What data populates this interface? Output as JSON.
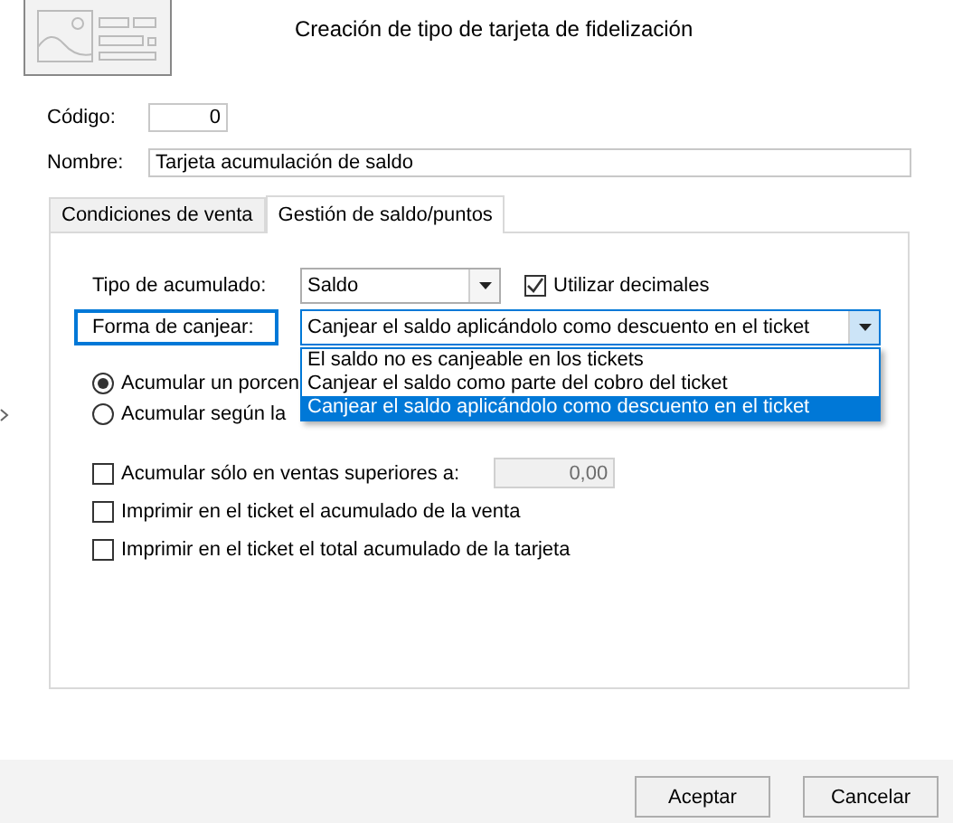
{
  "window": {
    "title": "Creación de tipo de tarjeta de fidelización"
  },
  "codigo": {
    "label": "Código:",
    "value": "0"
  },
  "nombre": {
    "label": "Nombre:",
    "value": "Tarjeta acumulación de saldo"
  },
  "tabs": [
    {
      "label": "Condiciones de venta",
      "selected": false
    },
    {
      "label": "Gestión de saldo/puntos",
      "selected": true
    }
  ],
  "tipo_acumulado": {
    "label": "Tipo de acumulado:",
    "value": "Saldo"
  },
  "utilizar_decimales": {
    "label": "Utilizar decimales",
    "checked": true
  },
  "forma_canjear": {
    "label": "Forma de canjear:",
    "value": "Canjear el saldo aplicándolo como descuento en el ticket",
    "expanded": true,
    "options": [
      {
        "label": "El saldo no es canjeable en los tickets",
        "selected": false
      },
      {
        "label": "Canjear el saldo como parte del cobro del ticket",
        "selected": false
      },
      {
        "label": "Canjear el saldo aplicándolo como descuento en el ticket",
        "selected": true
      }
    ]
  },
  "radios": [
    {
      "label": "Acumular un porcen",
      "selected": true
    },
    {
      "label": "Acumular según la",
      "selected": false
    }
  ],
  "checkboxes": [
    {
      "label": "Acumular sólo en ventas superiores a:",
      "checked": false,
      "amount": "0,00"
    },
    {
      "label": "Imprimir en el ticket el acumulado de la venta",
      "checked": false
    },
    {
      "label": "Imprimir en el ticket el total acumulado de la tarjeta",
      "checked": false
    }
  ],
  "buttons": [
    "Aceptar",
    "Cancelar"
  ]
}
